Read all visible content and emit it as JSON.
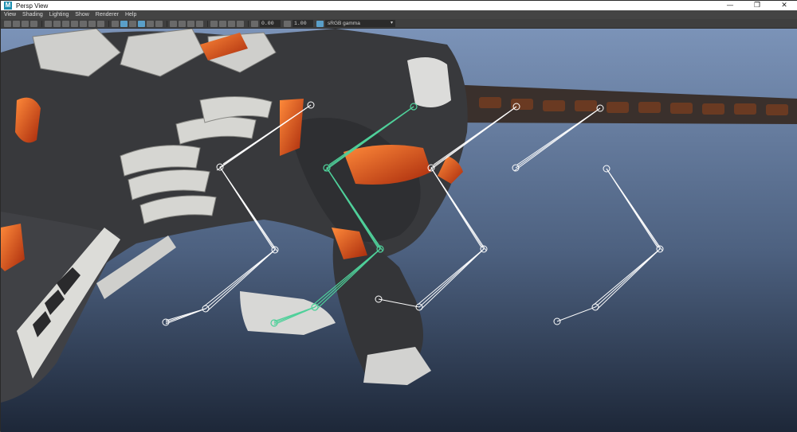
{
  "window": {
    "app_icon": "M",
    "title": "Persp View",
    "controls": {
      "minimize": "—",
      "maximize": "❐",
      "close": "✕"
    }
  },
  "menubar": {
    "items": [
      "View",
      "Shading",
      "Lighting",
      "Show",
      "Renderer",
      "Help"
    ]
  },
  "toolbar": {
    "exposure_value": "0.00",
    "gamma_value": "1.00",
    "color_space": "sRGB gamma",
    "icons": [
      "select-camera-icon",
      "lock-camera-icon",
      "bookmarks-icon",
      "image-plane-icon",
      "grid-icon",
      "film-gate-icon",
      "resolution-gate-icon",
      "gate-mask-icon",
      "field-chart-icon",
      "safe-action-icon",
      "safe-title-icon",
      "wireframe-icon",
      "smooth-shade-icon",
      "default-material-icon",
      "textured-icon",
      "use-lights-icon",
      "shadows-icon",
      "ambient-occlusion-icon",
      "motion-blur-icon",
      "antialiasing-icon",
      "depth-of-field-icon",
      "isolate-select-icon",
      "xray-icon",
      "xray-joints-icon",
      "xray-components-icon",
      "exposure-icon",
      "gamma-icon",
      "color-management-icon"
    ]
  },
  "viewport": {
    "background_top": "#7b93b8",
    "background_bottom": "#1d2738",
    "joint_color": "#ffffff",
    "selected_joint_color": "#4fd09a",
    "body_color": "#38393c",
    "glow_color": "#e2561c"
  }
}
